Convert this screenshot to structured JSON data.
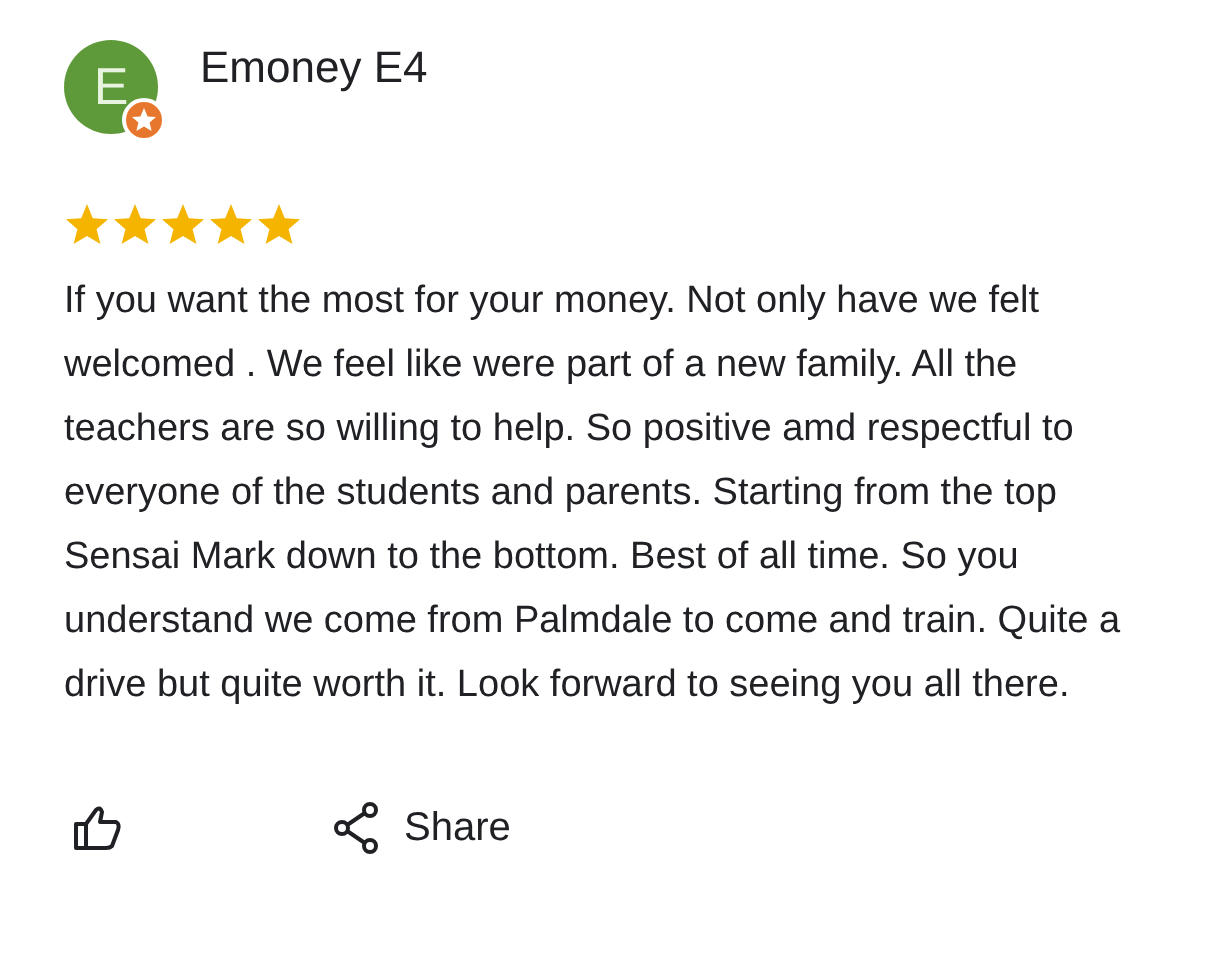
{
  "review": {
    "avatar_letter": "E",
    "author": "Emoney E4",
    "stars": 5,
    "text": "If you want the most for your money. Not only have we felt welcomed . We feel like were part of a new family. All the teachers are so willing to help. So positive amd respectful to everyone of the students and parents. Starting from the top Sensai Mark down to the bottom. Best of all time. So you understand we come from Palmdale to come and train. Quite a drive but quite worth it. Look forward to seeing you all there.",
    "actions": [
      {
        "kind": "like"
      },
      {
        "kind": "share",
        "label": "Share"
      }
    ]
  }
}
